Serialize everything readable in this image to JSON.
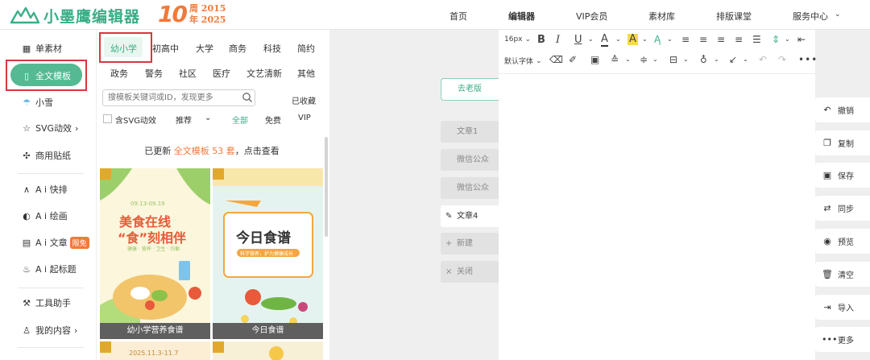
{
  "header": {
    "logo_text": "小墨鹰编辑器",
    "anniv_num": "10",
    "anniv_line1": "周 2015",
    "anniv_line2": "年 2025",
    "nav": [
      "首页",
      "编辑器",
      "VIP会员",
      "素材库",
      "排版课堂",
      "服务中心"
    ]
  },
  "sidebar": {
    "items": [
      "单素材",
      "全文模板",
      "小雪",
      "SVG动效",
      "商用贴纸",
      "A i 快排",
      "A i 绘画",
      "A i 文章",
      "A i 起标题",
      "工具助手",
      "我的内容"
    ],
    "free_badge": "限免",
    "chevron": "›"
  },
  "panel": {
    "tabs_row1": [
      "幼小学",
      "初高中",
      "大学",
      "商务",
      "科技",
      "简约"
    ],
    "tabs_row2": [
      "政务",
      "警务",
      "社区",
      "医疗",
      "文艺清新",
      "其他"
    ],
    "search_placeholder": "搜模板关键词或ID，发现更多",
    "saved": "已收藏",
    "svg_filter": "含SVG动效",
    "sort": "推荐",
    "filters": [
      "全部",
      "免费",
      "VIP"
    ],
    "notice_prefix": "已更新 ",
    "notice_highlight": "全文模板 53 套",
    "notice_suffix": "，点击查看",
    "cards": [
      {
        "label": "幼小学营养食谱",
        "date": "09.13-09.19",
        "title1": "美食在线",
        "title2": "“食”刻相伴",
        "sub": "健康 · 营养 · 卫生 · 均衡"
      },
      {
        "label": "今日食谱",
        "title": "今日食谱",
        "sub": "科学营养，护力健康成长"
      }
    ],
    "card3_date": "2025.11.3-11.7"
  },
  "articles": {
    "old_version": "去老版",
    "items": [
      "文章1",
      "微信公众",
      "微信公众",
      "文章4",
      "新建",
      "关闭"
    ]
  },
  "editor": {
    "font_size": "16px",
    "font_family": "默认字体"
  },
  "actions": [
    "撤销",
    "复制",
    "保存",
    "同步",
    "预览",
    "清空",
    "导入",
    "更多"
  ],
  "colors": {
    "brand_green": "#3aae86",
    "accent_orange": "#f07a3a",
    "highlight_red": "#d9363e"
  }
}
